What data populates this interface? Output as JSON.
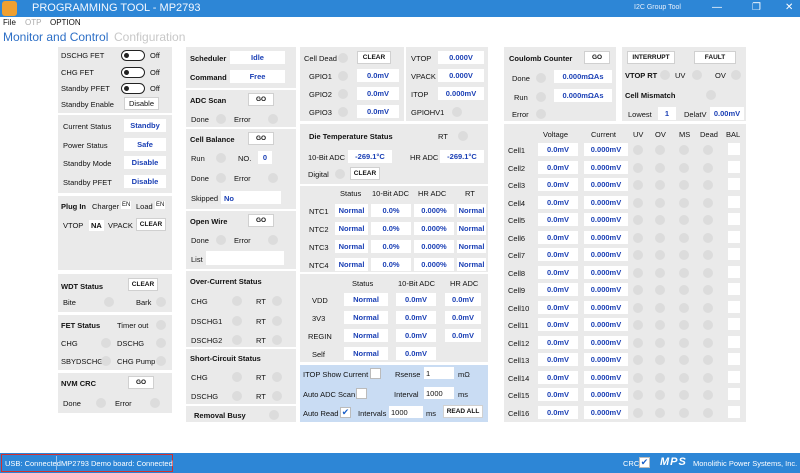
{
  "app": {
    "title": "PROGRAMMING TOOL - MP2793",
    "group_tool": "I2C Group Tool",
    "window_min": "—",
    "window_max": "❐",
    "window_close": "✕"
  },
  "menu": [
    "File",
    "OTP",
    "OPTION"
  ],
  "tabs": [
    "Monitor and Control",
    "Configuration"
  ],
  "fet": {
    "dschg": "DSCHG FET",
    "chg": "CHG FET",
    "standby_pfet": "Standby PFET",
    "off": "Off",
    "standby_enable": "Standby Enable",
    "disable_btn": "Disable"
  },
  "status": {
    "current_status_label": "Current Status",
    "current_status": "Standby",
    "power_status_label": "Power Status",
    "power_status": "Safe",
    "standby_mode_label": "Standby Mode",
    "standby_mode": "Disable",
    "standby_pfet_label": "Standby PFET",
    "standby_pfet": "Disable"
  },
  "plugin": {
    "title": "Plug In",
    "charger": "Charger",
    "charger_en": "EN",
    "load": "Load",
    "load_en": "EN",
    "vtop": "VTOP",
    "na": "NA",
    "vpack": "VPACK",
    "clear": "CLEAR"
  },
  "wdt": {
    "title": "WDT Status",
    "clear": "CLEAR",
    "bite": "Bite",
    "bark": "Bark"
  },
  "fet_status": {
    "title": "FET Status",
    "timer_out": "Timer out",
    "chg": "CHG",
    "dschg": "DSCHG",
    "sbydschg": "SBYDSCHG",
    "chg_pump": "CHG Pump"
  },
  "nvm": {
    "title": "NVM CRC",
    "go": "GO",
    "done": "Done",
    "error": "Error"
  },
  "scheduler": {
    "label": "Scheduler",
    "value": "Idle",
    "command_label": "Command",
    "command": "Free"
  },
  "adc_scan": {
    "title": "ADC Scan",
    "go": "GO",
    "done": "Done",
    "error": "Error"
  },
  "cell_balance": {
    "title": "Cell Balance",
    "go": "GO",
    "run": "Run",
    "no": "NO.",
    "no_value": "0",
    "done": "Done",
    "error": "Error",
    "skipped": "Skipped",
    "skipped_value": "No"
  },
  "open_wire": {
    "title": "Open Wire",
    "go": "GO",
    "done": "Done",
    "error": "Error",
    "list": "List"
  },
  "ocs": {
    "title": "Over-Current Status",
    "chg": "CHG",
    "rt1": "RT",
    "dschg1": "DSCHG1",
    "rt2": "RT",
    "dschg2": "DSCHG2",
    "rt3": "RT"
  },
  "scs": {
    "title": "Short-Circuit Status",
    "chg": "CHG",
    "rt1": "RT",
    "dschg": "DSCHG",
    "rt2": "RT"
  },
  "removal": {
    "title": "Removal Busy"
  },
  "gpio": {
    "cell_dead": "Cell Dead",
    "clear": "CLEAR",
    "gpio1": "GPIO1",
    "gpio1_val": "0.0mV",
    "gpio2": "GPIO2",
    "gpio2_val": "0.0mV",
    "gpio3": "GPIO3",
    "gpio3_val": "0.0mV"
  },
  "volt": {
    "vtop": "VTOP",
    "vtop_val": "0.000V",
    "vpack": "VPACK",
    "vpack_val": "0.000V",
    "itop": "ITOP",
    "itop_val": "0.000mV",
    "gpiohv1": "GPIOHV1"
  },
  "die_temp": {
    "title": "Die Temperature Status",
    "rt": "RT",
    "adc10": "10-Bit ADC",
    "adc10_val": "-269.1°C",
    "hr": "HR ADC",
    "hr_val": "-269.1°C",
    "digital": "Digital",
    "clear": "CLEAR"
  },
  "ntc": {
    "headers": [
      "Status",
      "10-Bit ADC",
      "HR ADC",
      "RT"
    ],
    "rows": [
      {
        "name": "NTC1",
        "status": "Normal",
        "adc": "0.0%",
        "hr": "0.000%",
        "rt": "Normal"
      },
      {
        "name": "NTC2",
        "status": "Normal",
        "adc": "0.0%",
        "hr": "0.000%",
        "rt": "Normal"
      },
      {
        "name": "NTC3",
        "status": "Normal",
        "adc": "0.0%",
        "hr": "0.000%",
        "rt": "Normal"
      },
      {
        "name": "NTC4",
        "status": "Normal",
        "adc": "0.0%",
        "hr": "0.000%",
        "rt": "Normal"
      }
    ]
  },
  "rails": {
    "headers": [
      "Status",
      "10-Bit ADC",
      "HR ADC"
    ],
    "rows": [
      {
        "name": "VDD",
        "status": "Normal",
        "adc": "0.0mV",
        "hr": "0.0mV"
      },
      {
        "name": "3V3",
        "status": "Normal",
        "adc": "0.0mV",
        "hr": "0.0mV"
      },
      {
        "name": "REGIN",
        "status": "Normal",
        "adc": "0.0mV",
        "hr": "0.0mV"
      },
      {
        "name": "Self",
        "status": "Normal",
        "adc": "0.0mV",
        "hr": ""
      }
    ]
  },
  "itop_ctrl": {
    "show_current": "ITOP Show Current",
    "rsense": "Rsense",
    "rsense_val": "1",
    "ohm": "mΩ",
    "auto_adc": "Auto ADC Scan",
    "interval": "Interval",
    "interval_val": "1000",
    "ms": "ms",
    "auto_read": "Auto Read",
    "check": "✔",
    "intervals": "Intervals",
    "intervals_val": "1000",
    "ms2": "ms",
    "read_all": "READ ALL"
  },
  "coulomb": {
    "title": "Coulomb Counter",
    "go": "GO",
    "done": "Done",
    "done_val": "0.000mΩAs",
    "run": "Run",
    "run_val": "0.000mΩAs",
    "error": "Error"
  },
  "interrupt": {
    "interrupt": "INTERRUPT",
    "fault": "FAULT",
    "vtop_rt": "VTOP RT",
    "uv": "UV",
    "ov": "OV",
    "cell_mismatch": "Cell Mismatch",
    "lowest": "Lowest",
    "lowest_val": "1",
    "delatv": "DelatV",
    "delatv_val": "0.00mV"
  },
  "cells": {
    "headers": [
      "Voltage",
      "Current",
      "UV",
      "OV",
      "MS",
      "Dead",
      "BAL"
    ],
    "rows": [
      {
        "name": "Cell1",
        "v": "0.0mV",
        "i": "0.000mV"
      },
      {
        "name": "Cell2",
        "v": "0.0mV",
        "i": "0.000mV"
      },
      {
        "name": "Cell3",
        "v": "0.0mV",
        "i": "0.000mV"
      },
      {
        "name": "Cell4",
        "v": "0.0mV",
        "i": "0.000mV"
      },
      {
        "name": "Cell5",
        "v": "0.0mV",
        "i": "0.000mV"
      },
      {
        "name": "Cell6",
        "v": "0.0mV",
        "i": "0.000mV"
      },
      {
        "name": "Cell7",
        "v": "0.0mV",
        "i": "0.000mV"
      },
      {
        "name": "Cell8",
        "v": "0.0mV",
        "i": "0.000mV"
      },
      {
        "name": "Cell9",
        "v": "0.0mV",
        "i": "0.000mV"
      },
      {
        "name": "Cell10",
        "v": "0.0mV",
        "i": "0.000mV"
      },
      {
        "name": "Cell11",
        "v": "0.0mV",
        "i": "0.000mV"
      },
      {
        "name": "Cell12",
        "v": "0.0mV",
        "i": "0.000mV"
      },
      {
        "name": "Cell13",
        "v": "0.0mV",
        "i": "0.000mV"
      },
      {
        "name": "Cell14",
        "v": "0.0mV",
        "i": "0.000mV"
      },
      {
        "name": "Cell15",
        "v": "0.0mV",
        "i": "0.000mV"
      },
      {
        "name": "Cell16",
        "v": "0.0mV",
        "i": "0.000mV"
      }
    ]
  },
  "statusbar": {
    "usb": "USB: Connected",
    "board": "MP2793 Demo board: Connected",
    "crc": "CRC",
    "check": "✔",
    "logo": "MPS",
    "company": "Monolithic Power Systems, Inc."
  },
  "colors": {
    "accent": "#2d86d6",
    "value_text": "#1a3fb5",
    "panel": "#eaeaea",
    "highlight_blue": "#c9dcf3",
    "status_outline": "#d03030"
  }
}
